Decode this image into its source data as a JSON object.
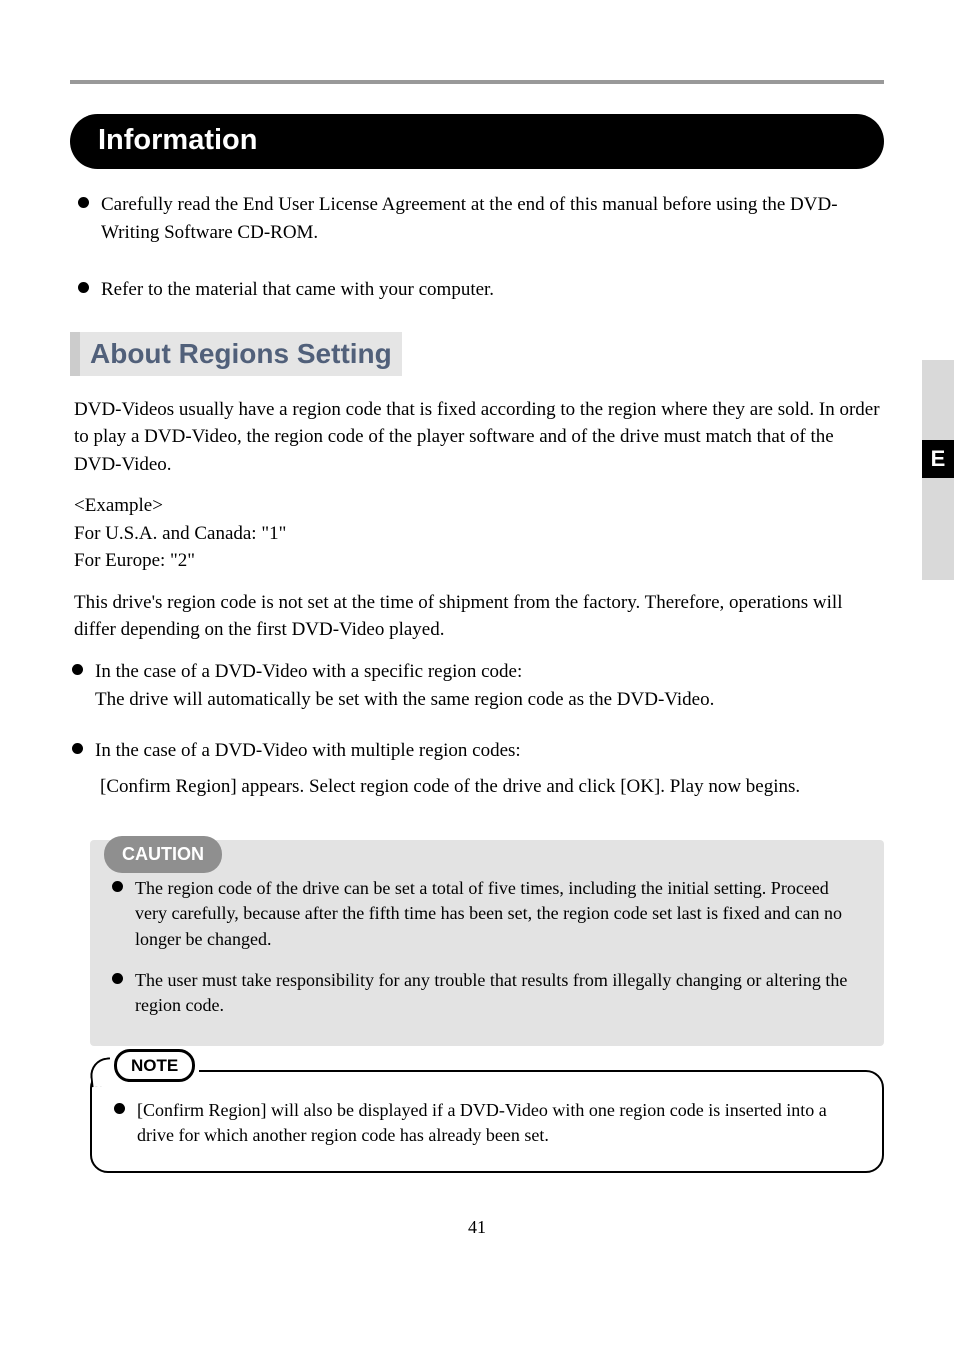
{
  "side_tab_letter": "E",
  "page_number": "41",
  "title": "Information",
  "intro_bullets": [
    "Carefully read the End User License Agreement at the end of this manual before using the DVD-Writing Software CD-ROM.",
    "Refer to the material that came with your computer."
  ],
  "section_heading": "About Regions Setting",
  "body_paragraphs": [
    "DVD-Videos usually have a region code that is fixed according to the region where they are sold. In order to play a DVD-Video, the region code of the player software and of the drive must match that of the DVD-Video.",
    "<Example>\nFor U.S.A. and Canada:  \"1\"\nFor Europe:  \"2\"",
    "This drive's region code is not set at the time of shipment from the factory. Therefore, operations will differ depending on the first DVD-Video played."
  ],
  "region_bullets": [
    {
      "label": "In the case of a DVD-Video with a specific region code:",
      "text": "The drive will automatically be set with the same region code as the DVD-Video."
    },
    {
      "label": "In the case of a DVD-Video with multiple region codes:",
      "text": "[Confirm Region] appears. Select region code of the drive and click [OK]. Play now begins."
    }
  ],
  "caution": {
    "label": "CAUTION",
    "items": [
      "The region code of the drive can be set a total of five times, including the initial setting. Proceed very carefully, because after the fifth time has been set, the region code set last is fixed and can no longer be changed.",
      "The user must take responsibility for any trouble that results from illegally changing or altering the region code."
    ]
  },
  "note": {
    "label": "NOTE",
    "items": [
      "[Confirm Region] will also be displayed if a DVD-Video with one region code is inserted into a drive for which another region code has already been set."
    ]
  }
}
